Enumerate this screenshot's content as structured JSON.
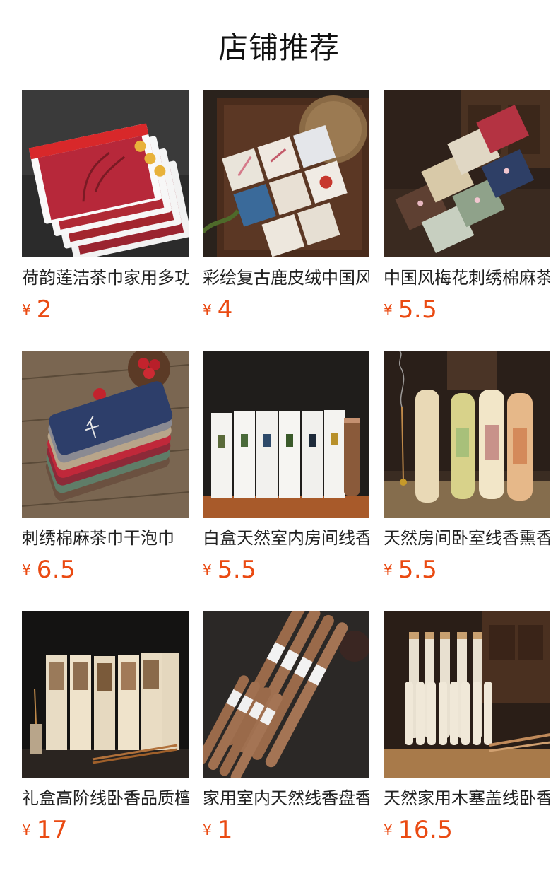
{
  "header": {
    "title": "店铺推荐"
  },
  "currency_symbol": "¥",
  "products": [
    {
      "name": "荷韵莲洁茶巾家用多功能",
      "price": "2",
      "image": "red-tea-towel-packs"
    },
    {
      "name": "彩绘复古鹿皮绒中国风茶巾",
      "price": "4",
      "image": "painted-tea-cloths-on-tray"
    },
    {
      "name": "中国风梅花刺绣棉麻茶巾",
      "price": "5.5",
      "image": "plum-embroidered-tea-cloths"
    },
    {
      "name": "刺绣棉麻茶巾干泡巾",
      "price": "6.5",
      "image": "stacked-linen-tea-towels"
    },
    {
      "name": "白盒天然室内房间线香",
      "price": "5.5",
      "image": "white-incense-boxes"
    },
    {
      "name": "天然房间卧室线香熏香",
      "price": "5.5",
      "image": "incense-tubes-with-burning-stick"
    },
    {
      "name": "礼盒高阶线卧香品质檀香",
      "price": "17",
      "image": "incense-gift-boxes"
    },
    {
      "name": "家用室内天然线香盘香",
      "price": "1",
      "image": "incense-stick-tubes"
    },
    {
      "name": "天然家用木塞盖线卧香",
      "price": "16.5",
      "image": "cork-capped-incense-tubes"
    }
  ]
}
